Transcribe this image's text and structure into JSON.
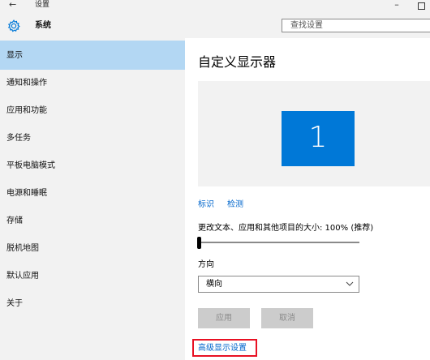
{
  "window": {
    "title": "设置",
    "back_glyph": "←",
    "minimize_glyph": "–"
  },
  "header": {
    "section_title": "系统",
    "search_placeholder": "查找设置"
  },
  "sidebar": {
    "items": [
      {
        "label": "显示",
        "selected": true
      },
      {
        "label": "通知和操作",
        "selected": false
      },
      {
        "label": "应用和功能",
        "selected": false
      },
      {
        "label": "多任务",
        "selected": false
      },
      {
        "label": "平板电脑模式",
        "selected": false
      },
      {
        "label": "电源和睡眠",
        "selected": false
      },
      {
        "label": "存储",
        "selected": false
      },
      {
        "label": "脱机地图",
        "selected": false
      },
      {
        "label": "默认应用",
        "selected": false
      },
      {
        "label": "关于",
        "selected": false
      }
    ]
  },
  "main": {
    "title": "自定义显示器",
    "monitor_number": "1",
    "identify_link": "标识",
    "detect_link": "检测",
    "scale_label": "更改文本、应用和其他项目的大小: 100% (推荐)",
    "scale_slider_fraction": 0,
    "orientation_label": "方向",
    "orientation_value": "横向",
    "apply_button": "应用",
    "cancel_button": "取消",
    "advanced_link": "高级显示设置"
  },
  "colors": {
    "accent": "#0078d7",
    "selection": "#b3d7f3",
    "sidebar_bg": "#f2f2f2",
    "link": "#0066cc",
    "highlight_box": "#e81123"
  },
  "icons": {
    "back": "arrow-left-icon",
    "settings": "gear-icon",
    "dropdown": "chevron-down-icon"
  }
}
